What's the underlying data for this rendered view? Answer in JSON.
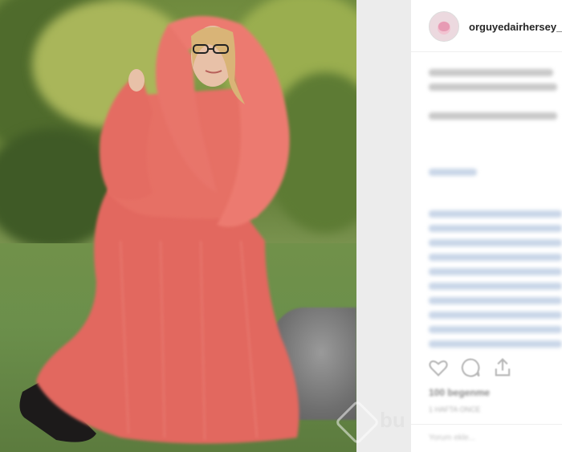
{
  "post": {
    "username": "orguyedairhersey_",
    "likes_text": "100 begenme",
    "age_text": "1 HAFTA ONCE",
    "comment_placeholder": "Yorum ekle..."
  },
  "icons": [
    "heart-icon",
    "comment-icon",
    "share-icon"
  ],
  "watermark": {
    "text": "bu"
  },
  "colors": {
    "accent_blue": "#c9d6e8",
    "text": "#262626"
  }
}
